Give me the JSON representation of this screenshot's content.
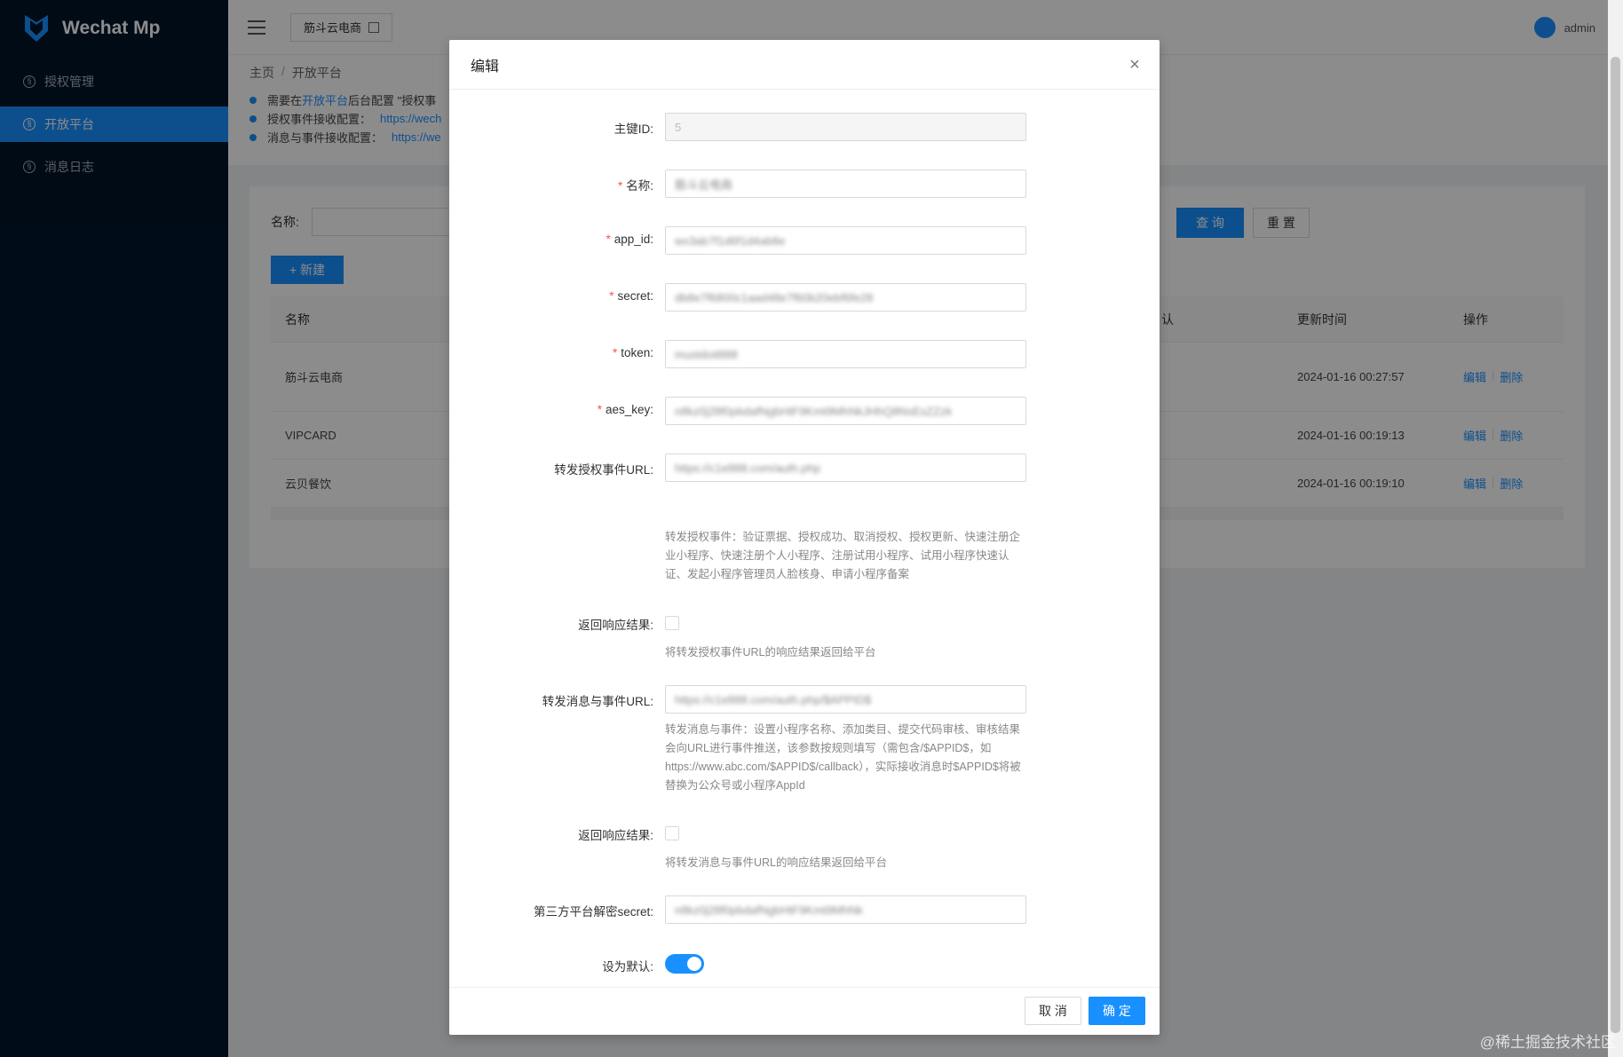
{
  "app": {
    "title": "Wechat Mp",
    "user": "admin",
    "tenant": "筋斗云电商"
  },
  "sidebar": {
    "items": [
      {
        "label": "授权管理"
      },
      {
        "label": "开放平台"
      },
      {
        "label": "消息日志"
      }
    ]
  },
  "breadcrumb": [
    "主页",
    "开放平台"
  ],
  "notice": {
    "line1_prefix": "需要在",
    "line1_link": "开放平台",
    "line1_suffix": "后台配置 \"授权事",
    "line2_label": "授权事件接收配置：",
    "line2_link": "https://wech",
    "line3_label": "消息与事件接收配置：",
    "line3_link": "https://we"
  },
  "search": {
    "label": "名称:",
    "query": "查 询",
    "reset": "重 置",
    "new": "+ 新建"
  },
  "table": {
    "headers": {
      "name": "名称",
      "default": "认",
      "time": "更新时间",
      "ops": "操作"
    },
    "rows": [
      {
        "name": "筋斗云电商",
        "time": "2024-01-16 00:27:57",
        "edit": "编辑",
        "del": "删除"
      },
      {
        "name": "VIPCARD",
        "time": "2024-01-16 00:19:13",
        "edit": "编辑",
        "del": "删除"
      },
      {
        "name": "云贝餐饮",
        "time": "2024-01-16 00:19:10",
        "edit": "编辑",
        "del": "删除"
      }
    ]
  },
  "modal": {
    "title": "编辑",
    "close": "×",
    "fields": {
      "id_label": "主键ID:",
      "id_value": "5",
      "name_label": "名称:",
      "name_value": "筋斗云电商",
      "appid_label": "app_id:",
      "appid_value": "wx3ab7f1d6f1d4ab8e",
      "secret_label": "secret:",
      "secret_value": "db8e7f6800c1aad48e7f60b20ebf6fe28",
      "token_label": "token:",
      "token_value": "mustdoit888",
      "aeskey_label": "aes_key:",
      "aeskey_value": "n8kz0j28f0pbdafNgbHtF9Kmt9MhNkJHhQ8NsEsZZzk",
      "auth_url_label": "转发授权事件URL:",
      "auth_url_value": "https://c1e888.com/auth.php",
      "auth_help": "转发授权事件：验证票据、授权成功、取消授权、授权更新、快速注册企业小程序、快速注册个人小程序、注册试用小程序、试用小程序快速认证、发起小程序管理员人脸核身、申请小程序备案",
      "auth_resp_label": "返回响应结果:",
      "auth_resp_help": "将转发授权事件URL的响应结果返回给平台",
      "msg_url_label": "转发消息与事件URL:",
      "msg_url_value": "https://c1e888.com/auth.php/$APPID$",
      "msg_help": "转发消息与事件：设置小程序名称、添加类目、提交代码审核、审核结果 会向URL进行事件推送，该参数按规则填写（需包含/$APPID$，如https://www.abc.com/$APPID$/callback），实际接收消息时$APPID$将被替换为公众号或小程序AppId",
      "msg_resp_label": "返回响应结果:",
      "msg_resp_help": "将转发消息与事件URL的响应结果返回给平台",
      "decrypt_label": "第三方平台解密secret:",
      "decrypt_value": "n8kz0j28f0pbdafNgbHtF9Kmt9MhNk",
      "default_label": "设为默认:"
    },
    "cancel": "取 消",
    "ok": "确 定"
  },
  "watermark": "@稀土掘金技术社区",
  "colors": {
    "primary": "#1890ff",
    "sidebar": "#001529",
    "danger": "#ff4d4f"
  }
}
